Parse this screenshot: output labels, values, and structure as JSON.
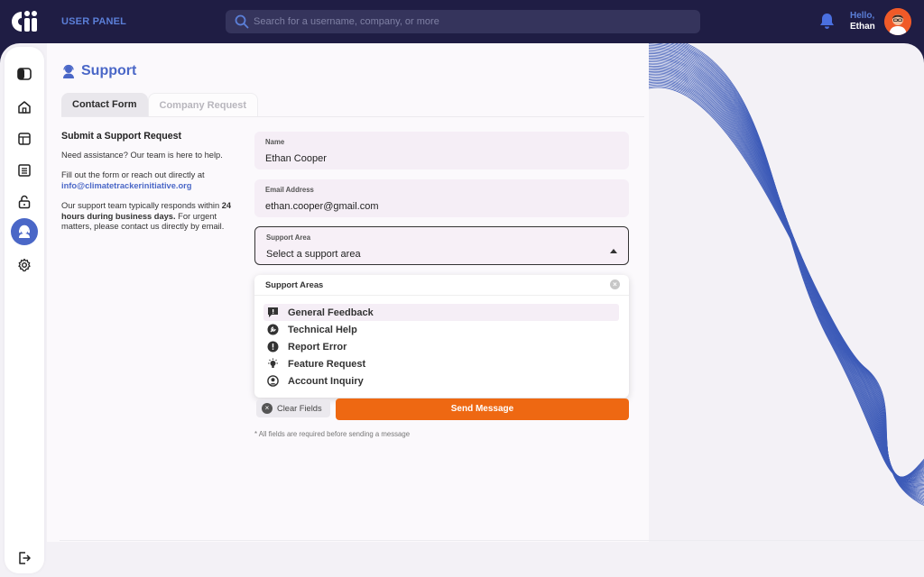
{
  "topbar": {
    "panel_title": "USER PANEL",
    "search_placeholder": "Search for a username, company, or more",
    "greeting": "Hello,",
    "user_name": "Ethan"
  },
  "sidebar": {
    "items": [
      {
        "icon": "panel-toggle-icon",
        "active": false
      },
      {
        "icon": "home-icon",
        "active": false
      },
      {
        "icon": "table-icon",
        "active": false
      },
      {
        "icon": "list-icon",
        "active": false
      },
      {
        "icon": "lock-icon",
        "active": false
      },
      {
        "icon": "support-icon",
        "active": true
      },
      {
        "icon": "gear-icon",
        "active": false
      }
    ],
    "logout_icon": "logout-icon"
  },
  "page": {
    "title": "Support",
    "tabs": [
      {
        "label": "Contact Form",
        "active": true
      },
      {
        "label": "Company Request",
        "active": false
      }
    ]
  },
  "info": {
    "heading": "Submit a Support Request",
    "p1": "Need assistance? Our team is here to help.",
    "p2_prefix": "Fill out the form or reach out directly at",
    "email": "info@climatetrackerinitiative.org",
    "p3_a": "Our support team typically responds within",
    "p3_bold": "24 hours during business days.",
    "p3_b": "For urgent matters, please contact us directly by email."
  },
  "form": {
    "name_label": "Name",
    "name_value": "Ethan Cooper",
    "email_label": "Email Address",
    "email_value": "ethan.cooper@gmail.com",
    "area_label": "Support Area",
    "area_value": "Select a support area"
  },
  "dropdown": {
    "title": "Support Areas",
    "options": [
      {
        "label": "General Feedback",
        "icon": "feedback-icon"
      },
      {
        "label": "Technical Help",
        "icon": "wrench-icon"
      },
      {
        "label": "Report Error",
        "icon": "alert-icon"
      },
      {
        "label": "Feature Request",
        "icon": "lightbulb-icon"
      },
      {
        "label": "Account Inquiry",
        "icon": "account-icon"
      }
    ]
  },
  "actions": {
    "clear_label": "Clear Fields",
    "send_label": "Send Message"
  },
  "note": "* All fields are required before sending a message",
  "colors": {
    "accent": "#4a67c7",
    "send": "#ee6812",
    "topbar": "#1f1d44"
  }
}
